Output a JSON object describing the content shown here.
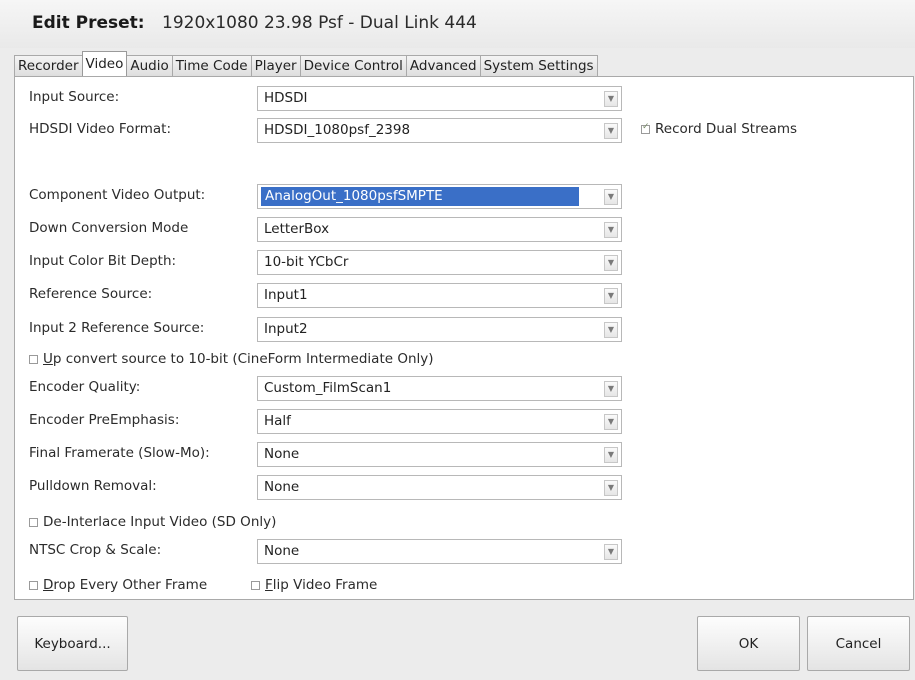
{
  "title": {
    "label": "Edit Preset:",
    "value": "1920x1080 23.98 Psf - Dual Link 444"
  },
  "tabs": [
    "Recorder",
    "Video",
    "Audio",
    "Time Code",
    "Player",
    "Device Control",
    "Advanced",
    "System Settings"
  ],
  "active_tab": "Video",
  "fields": {
    "input_source": {
      "label": "Input Source:",
      "value": "HDSDI"
    },
    "hdsdi_format": {
      "label": "HDSDI Video Format:",
      "value": "HDSDI_1080psf_2398"
    },
    "record_dual": {
      "label": "Record Dual Streams",
      "checked": true
    },
    "component_out": {
      "label": "Component Video Output:",
      "value": "AnalogOut_1080psfSMPTE"
    },
    "down_conv": {
      "label": "Down Conversion Mode",
      "value": "LetterBox"
    },
    "color_depth": {
      "label": "Input Color Bit Depth:",
      "value": "10-bit YCbCr"
    },
    "ref_source": {
      "label": "Reference Source:",
      "value": "Input1"
    },
    "input2_ref": {
      "label": "Input 2 Reference Source:",
      "value": "Input2"
    },
    "upconvert": {
      "label_u": "U",
      "label_rest": "p convert source to 10-bit (CineForm Intermediate Only)",
      "checked": false
    },
    "enc_quality": {
      "label": "Encoder Quality:",
      "value": "Custom_FilmScan1"
    },
    "enc_preemph": {
      "label": "Encoder PreEmphasis:",
      "value": "Half"
    },
    "final_fr": {
      "label": "Final Framerate (Slow-Mo):",
      "value": "None"
    },
    "pulldown": {
      "label": "Pulldown Removal:",
      "value": "None"
    },
    "deinterlace": {
      "label": "De-Interlace Input Video (SD Only)",
      "checked": false
    },
    "ntsc_crop": {
      "label": "NTSC Crop & Scale:",
      "value": "None"
    },
    "drop_frame": {
      "label_u": "D",
      "label_rest": "rop Every Other Frame",
      "checked": false
    },
    "flip": {
      "label_u": "F",
      "label_rest": "lip Video Frame",
      "checked": false
    }
  },
  "buttons": {
    "keyboard": "Keyboard...",
    "ok": "OK",
    "cancel": "Cancel"
  }
}
